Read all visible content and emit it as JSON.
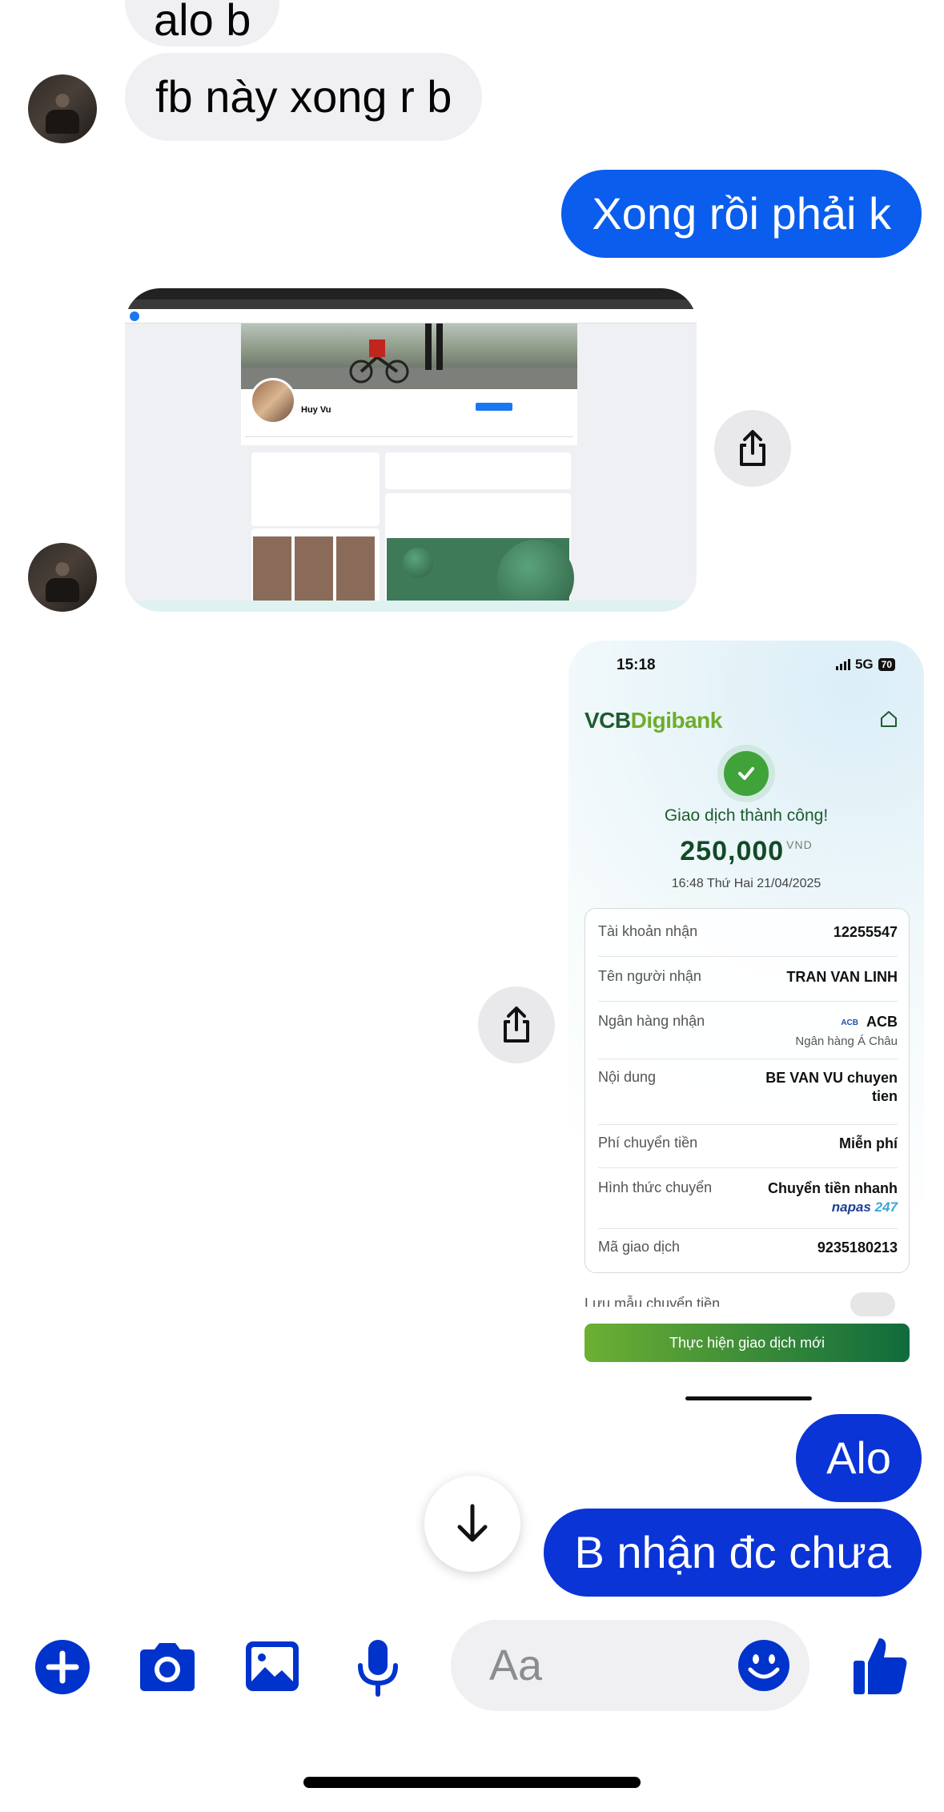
{
  "messages": [
    {
      "id": "m1",
      "direction": "incoming",
      "text": "alo b"
    },
    {
      "id": "m2",
      "direction": "incoming",
      "text": "fb này xong r b"
    },
    {
      "id": "m3",
      "direction": "outgoing",
      "text": "Xong rồi phải k"
    },
    {
      "id": "m4",
      "direction": "incoming",
      "type": "image",
      "content": "facebook-profile-screenshot"
    },
    {
      "id": "m5",
      "direction": "outgoing",
      "type": "image",
      "content": "bank-transfer-receipt"
    },
    {
      "id": "m6",
      "direction": "outgoing",
      "text": "Alo"
    },
    {
      "id": "m7",
      "direction": "outgoing",
      "text": "B nhận đc chưa"
    }
  ],
  "fb_screenshot": {
    "profile_name": "Huy Vu"
  },
  "receipt": {
    "status_time": "15:18",
    "network": "5G",
    "battery": "70",
    "brand_a": "VCB",
    "brand_b": "Digibank",
    "success": "Giao dịch thành công!",
    "amount": "250,000",
    "currency": "VND",
    "datetime": "16:48 Thứ Hai 21/04/2025",
    "rows": {
      "account": {
        "label": "Tài khoản nhận",
        "value": "12255547"
      },
      "recipient": {
        "label": "Tên người nhận",
        "value": "TRAN VAN LINH"
      },
      "bank": {
        "label": "Ngân hàng nhận",
        "value": "ACB",
        "sub": "Ngân hàng Á Châu",
        "mark": "ACB"
      },
      "content": {
        "label": "Nội dung",
        "value_line1": "BE VAN VU chuyen",
        "value_line2": "tien"
      },
      "fee": {
        "label": "Phí chuyển tiền",
        "value": "Miễn phí"
      },
      "method": {
        "label": "Hình thức chuyển",
        "value": "Chuyển tiền nhanh",
        "napas_a": "napas",
        "napas_b": "247"
      },
      "txid": {
        "label": "Mã giao dịch",
        "value": "9235180213"
      }
    },
    "save_template": "Lưu mẫu chuyển tiền",
    "new_transaction": "Thực hiện giao dịch mới"
  },
  "composer": {
    "placeholder": "Aa"
  },
  "icons": {
    "plus": "plus-circle-icon",
    "camera": "camera-icon",
    "gallery": "image-icon",
    "mic": "microphone-icon",
    "emoji": "emoji-icon",
    "like": "thumbs-up-icon",
    "share": "share-icon",
    "scroll": "arrow-down-icon"
  },
  "colors": {
    "accent": "#0a5ded",
    "outgoing_dark": "#0b34d6",
    "icon_blue": "#0033cc",
    "incoming_bg": "#f0f0f3"
  }
}
